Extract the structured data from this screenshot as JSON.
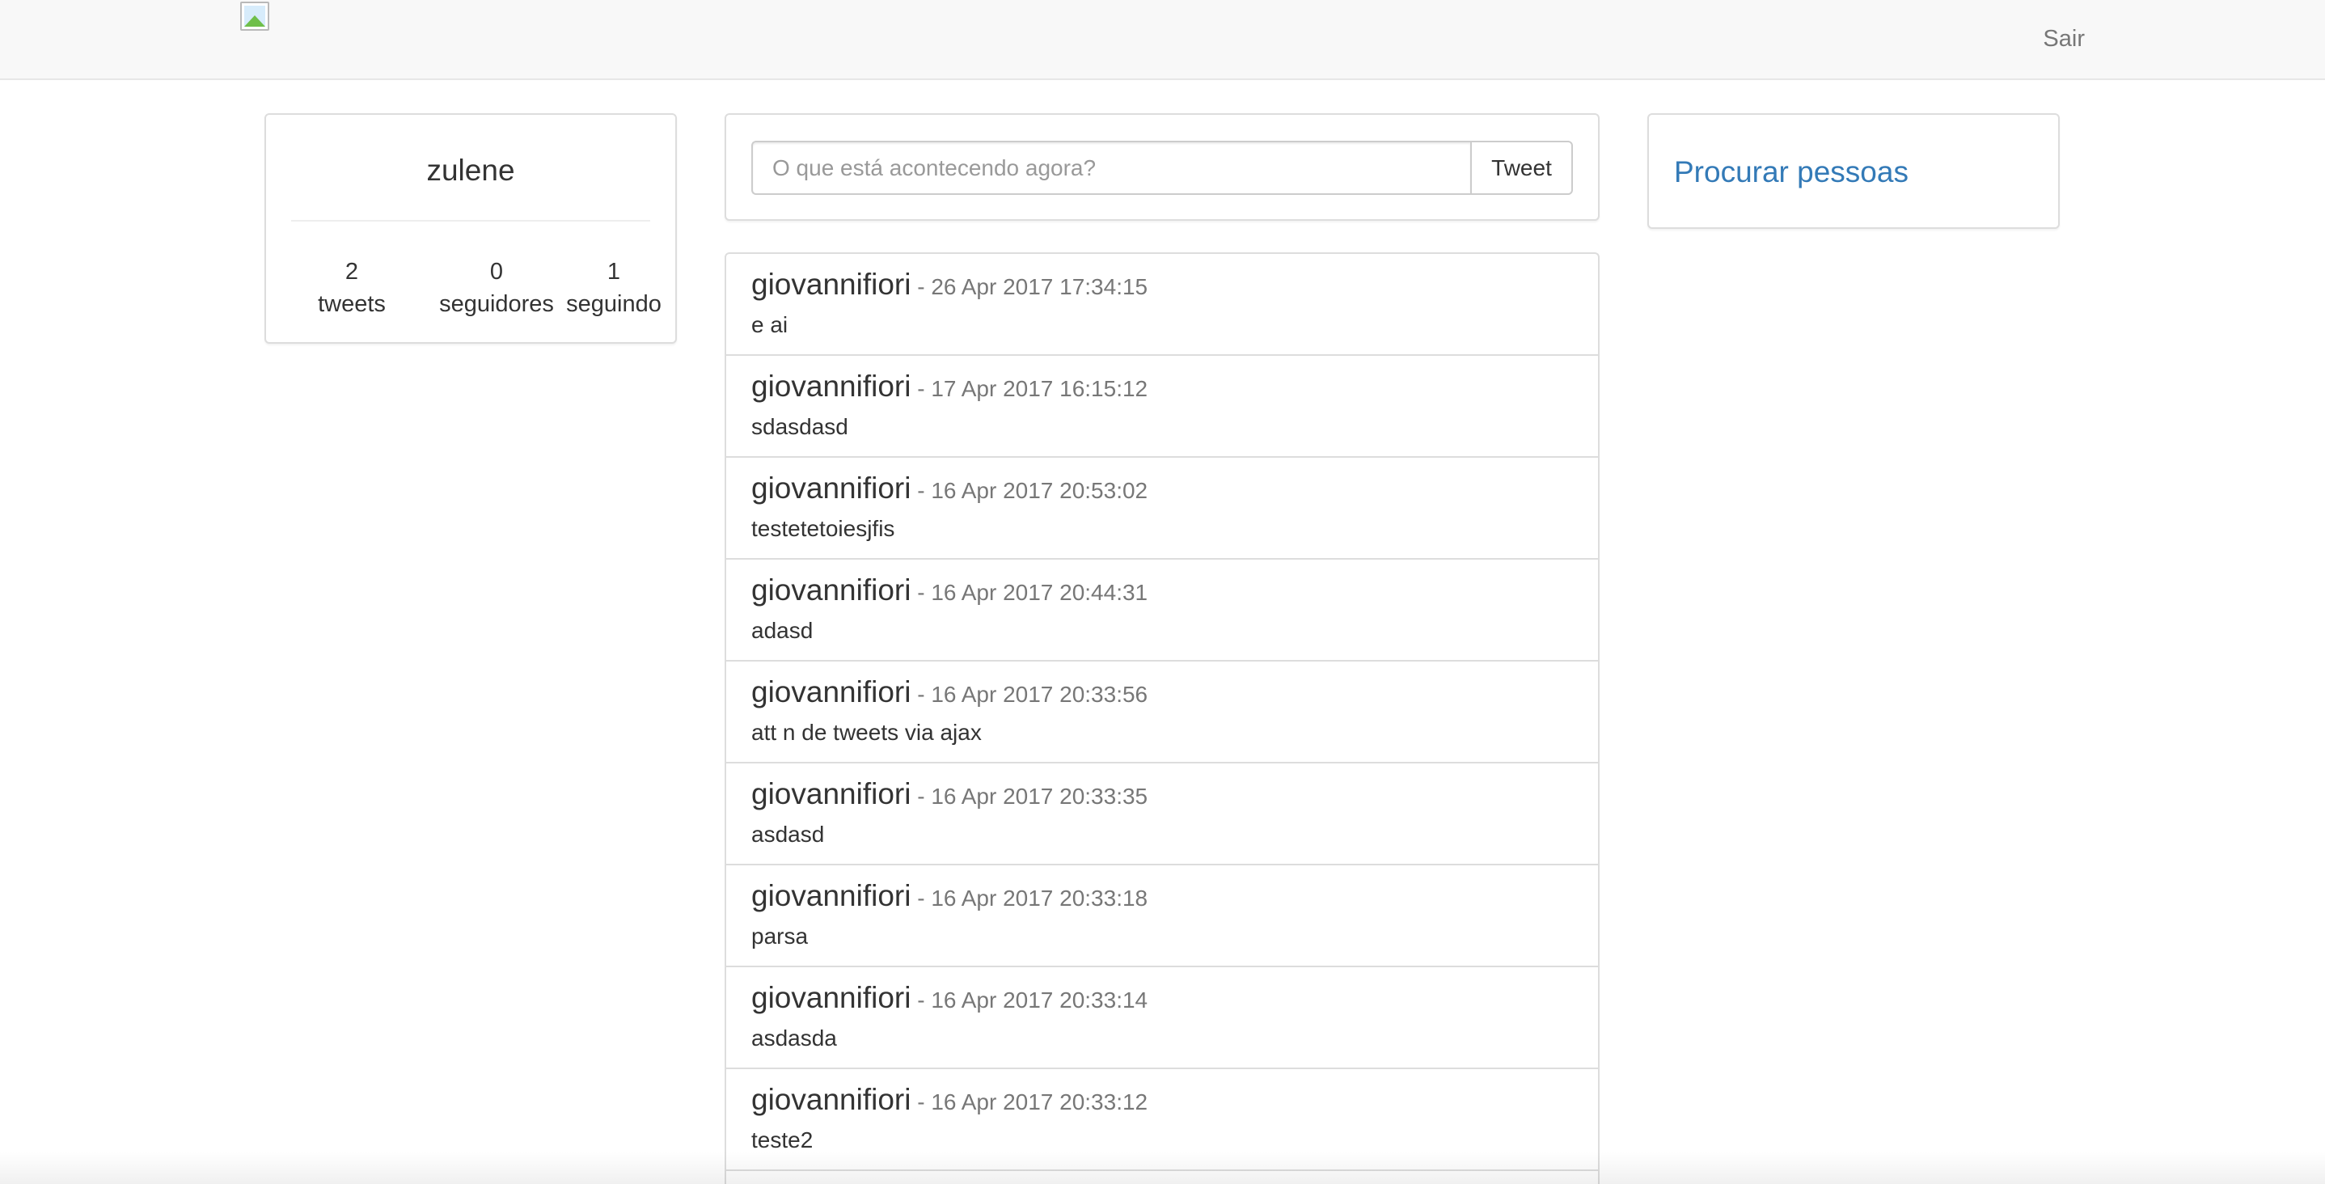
{
  "navbar": {
    "logo_icon": "broken-image-icon",
    "logout_label": "Sair"
  },
  "profile": {
    "username": "zulene",
    "stats": [
      {
        "value": "2",
        "label": "tweets"
      },
      {
        "value": "0",
        "label": "seguidores"
      },
      {
        "value": "1",
        "label": "seguindo"
      }
    ]
  },
  "compose": {
    "placeholder": "O que está acontecendo agora?",
    "value": "",
    "button_label": "Tweet"
  },
  "search": {
    "link_label": "Procurar pessoas"
  },
  "feed": [
    {
      "author": "giovannifiori",
      "date": " - 26 Apr 2017 17:34:15",
      "text": "e ai"
    },
    {
      "author": "giovannifiori",
      "date": " - 17 Apr 2017 16:15:12",
      "text": "sdasdasd"
    },
    {
      "author": "giovannifiori",
      "date": " - 16 Apr 2017 20:53:02",
      "text": "testetetoiesjfis"
    },
    {
      "author": "giovannifiori",
      "date": " - 16 Apr 2017 20:44:31",
      "text": "adasd"
    },
    {
      "author": "giovannifiori",
      "date": " - 16 Apr 2017 20:33:56",
      "text": "att n de tweets via ajax"
    },
    {
      "author": "giovannifiori",
      "date": " - 16 Apr 2017 20:33:35",
      "text": "asdasd"
    },
    {
      "author": "giovannifiori",
      "date": " - 16 Apr 2017 20:33:18",
      "text": "parsa"
    },
    {
      "author": "giovannifiori",
      "date": " - 16 Apr 2017 20:33:14",
      "text": "asdasda"
    },
    {
      "author": "giovannifiori",
      "date": " - 16 Apr 2017 20:33:12",
      "text": "teste2"
    }
  ],
  "colors": {
    "navbar_bg": "#f8f8f8",
    "link": "#337ab7",
    "muted": "#777777",
    "border": "#dddddd"
  }
}
